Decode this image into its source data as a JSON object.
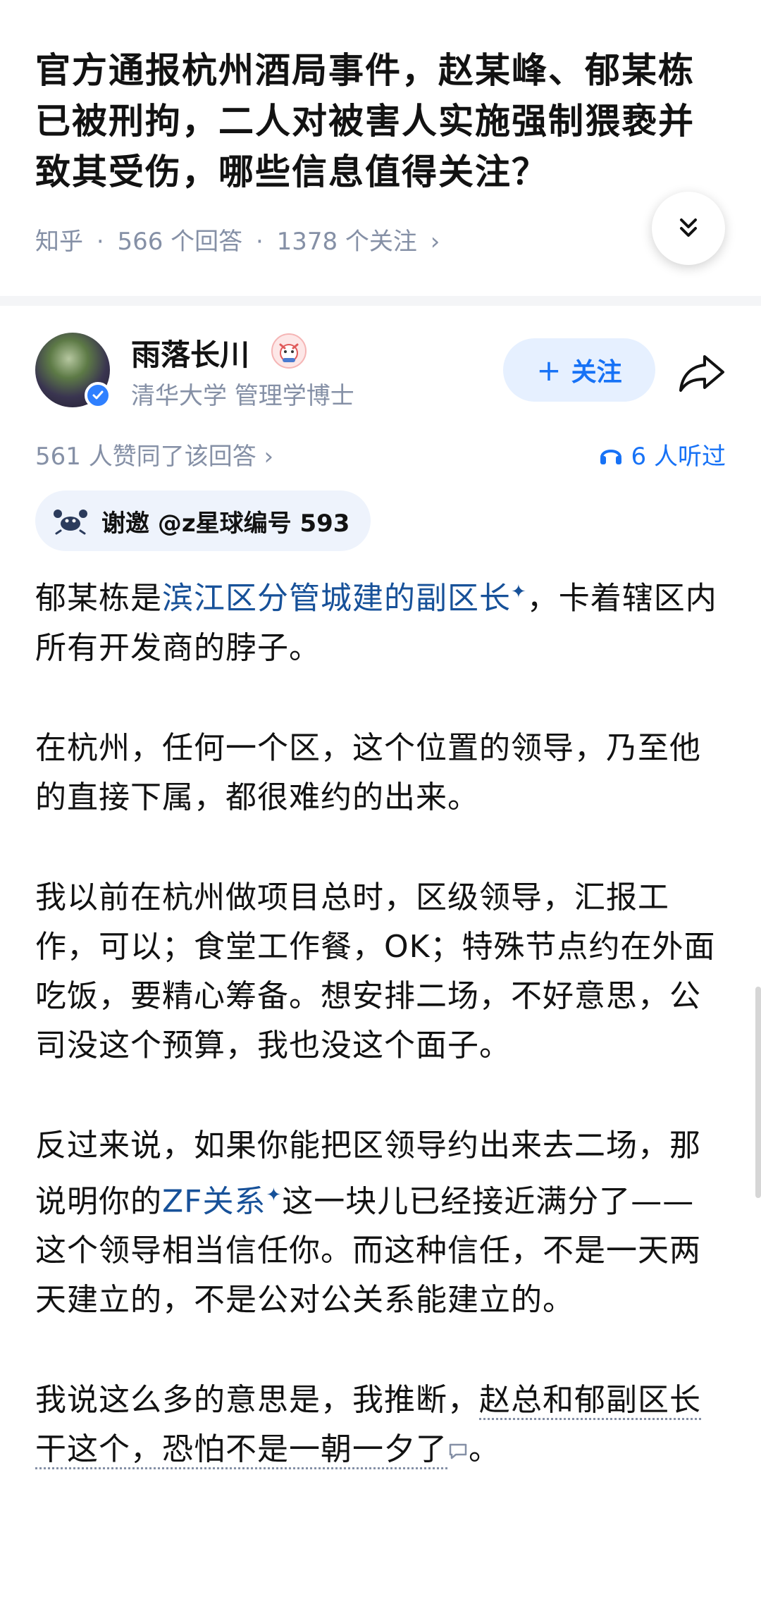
{
  "question": {
    "title": "官方通报杭州酒局事件，赵某峰、郁某栋已被刑拘，二人对被害人实施强制猥亵并致其受伤，哪些信息值得关注？",
    "meta": {
      "site": "知乎",
      "sep": "·",
      "answers": "566 个回答",
      "followers": "1378 个关注",
      "chevron": "›"
    }
  },
  "author": {
    "name": "雨落长川",
    "desc": "清华大学 管理学博士",
    "follow_plus": "+",
    "follow_label": "关注"
  },
  "stats": {
    "likes": "561 人赞同了该回答 ›",
    "listen": "6 人听过"
  },
  "invite": {
    "label": "谢邀 @z星球编号 593"
  },
  "content": {
    "p1_a": "郁某栋是",
    "p1_link": "滨江区分管城建的副区长",
    "p1_b": "，卡着辖区内所有开发商的脖子。",
    "p2": "在杭州，任何一个区，这个位置的领导，乃至他的直接下属，都很难约的出来。",
    "p3": "我以前在杭州做项目总时，区级领导，汇报工作，可以；食堂工作餐，OK；特殊节点约在外面吃饭，要精心筹备。想安排二场，不好意思，公司没这个预算，我也没这个面子。",
    "p4_a": "反过来说，如果你能把区领导约出来去二场，那说明你的",
    "p4_link": "ZF关系",
    "p4_b": "这一块儿已经接近满分了——这个领导相当信任你。而这种信任，不是一天两天建立的，不是公对公关系能建立的。",
    "p5_a": "我说这么多的意思是，我推断，",
    "p5_b": "赵总和郁副区长干这个，恐怕不是一朝一夕了",
    "p5_c": "。",
    "spark": "✦"
  },
  "colors": {
    "link": "#175199",
    "accent": "#1772f6",
    "meta": "#8590a6"
  },
  "icons": [
    "chevrons-down-icon",
    "verified-icon",
    "badge-icon",
    "share-icon",
    "headphones-icon",
    "crab-icon",
    "comment-icon"
  ]
}
